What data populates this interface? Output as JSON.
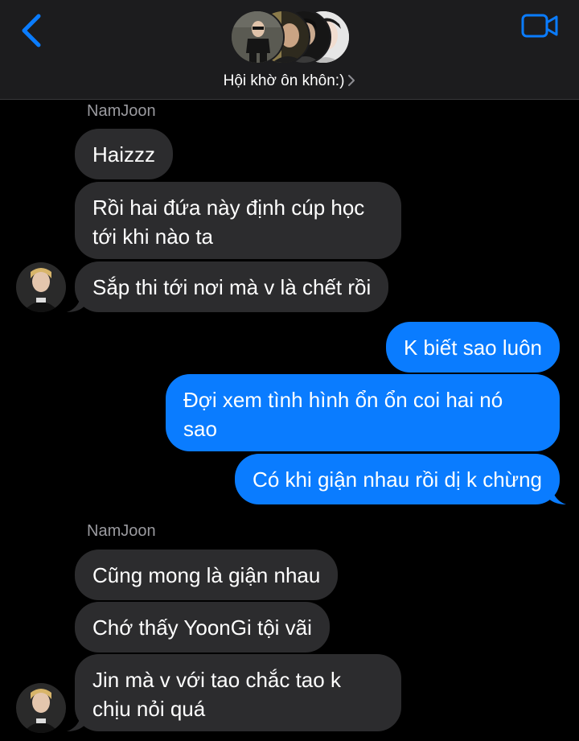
{
  "header": {
    "group_name": "Hội khờ ôn khôn:)",
    "accent_color": "#0a7cff",
    "back_icon": "chevron-left-icon",
    "video_icon": "video-camera-icon"
  },
  "thread": [
    {
      "sender": "NamJoon",
      "direction": "incoming",
      "messages": [
        "Haizzz",
        "Rồi hai đứa này định cúp học tới khi nào ta",
        "Sắp thi tới nơi mà v là chết rồi"
      ]
    },
    {
      "direction": "outgoing",
      "messages": [
        "K biết sao luôn",
        "Đợi xem tình hình ổn ổn coi hai nó sao",
        "Có khi giận nhau rồi dị k chừng"
      ]
    },
    {
      "sender": "NamJoon",
      "direction": "incoming",
      "messages": [
        "Cũng mong là giận nhau",
        "Chớ thấy YoonGi tội vãi",
        "Jin mà v với tao chắc tao k chịu nỏi quá"
      ]
    }
  ],
  "colors": {
    "incoming_bubble": "#2c2c2e",
    "outgoing_bubble": "#0a7cff",
    "header_bg": "#1c1c1e",
    "sender_name": "#9a9a9f"
  }
}
